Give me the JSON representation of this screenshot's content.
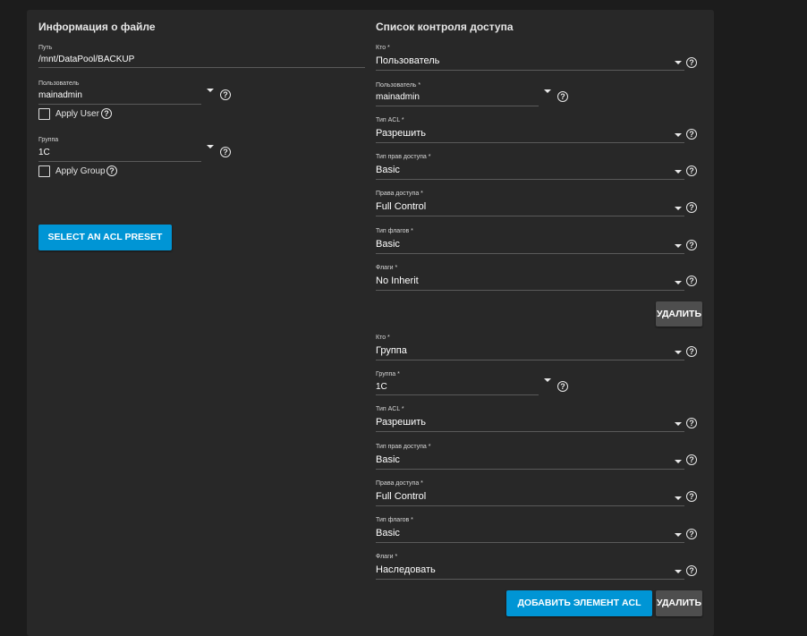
{
  "file_info": {
    "title": "Информация о файле",
    "path_label": "Путь",
    "path_value": "/mnt/DataPool/BACKUP",
    "user_label": "Пользователь",
    "user_value": "mainadmin",
    "apply_user_label": "Apply User",
    "group_label": "Группа",
    "group_value": "1C",
    "apply_group_label": "Apply Group",
    "preset_button": "SELECT AN ACL PRESET"
  },
  "acl": {
    "title": "Список контроля доступа",
    "entries": [
      {
        "who_label": "Кто *",
        "who_value": "Пользователь",
        "subject_label": "Пользователь *",
        "subject_value": "mainadmin",
        "acl_type_label": "Тип ACL *",
        "acl_type_value": "Разрешить",
        "perm_type_label": "Тип прав доступа *",
        "perm_type_value": "Basic",
        "perms_label": "Права доступа *",
        "perms_value": "Full Control",
        "flag_type_label": "Тип флагов *",
        "flag_type_value": "Basic",
        "flags_label": "Флаги *",
        "flags_value": "No Inherit",
        "delete_label": "УДАЛИТЬ"
      },
      {
        "who_label": "Кто *",
        "who_value": "Группа",
        "subject_label": "Группа *",
        "subject_value": "1C",
        "acl_type_label": "Тип ACL *",
        "acl_type_value": "Разрешить",
        "perm_type_label": "Тип прав доступа *",
        "perm_type_value": "Basic",
        "perms_label": "Права доступа *",
        "perms_value": "Full Control",
        "flag_type_label": "Тип флагов *",
        "flag_type_value": "Basic",
        "flags_label": "Флаги *",
        "flags_value": "Наследовать",
        "delete_label": "УДАЛИТЬ"
      }
    ],
    "add_button": "ДОБАВИТЬ ЭЛЕМЕНТ ACL"
  },
  "icons": {
    "help": "help-circle-icon",
    "dropdown": "caret-down-icon",
    "checkbox": "checkbox-unchecked-icon"
  },
  "colors": {
    "background": "#1c1c1c",
    "card": "#282828",
    "primary_button": "#0095d5",
    "secondary_button": "#4e4e4e"
  }
}
